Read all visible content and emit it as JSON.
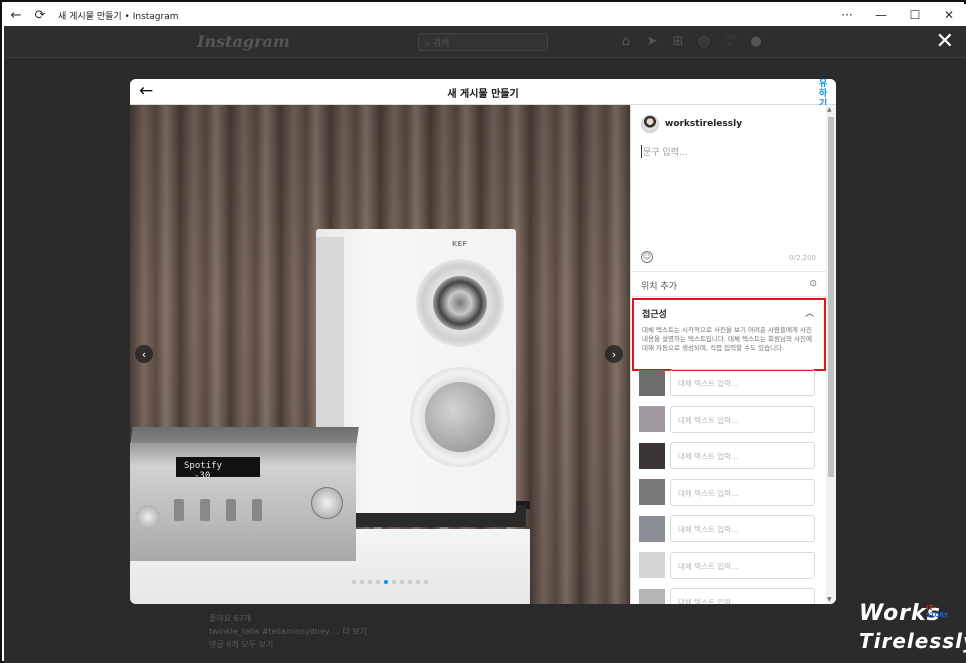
{
  "window": {
    "title": "새 게시물 만들기 • Instagram",
    "back_glyph": "←",
    "refresh_glyph": "⟳",
    "more_glyph": "···",
    "minimize_glyph": "—",
    "maximize_glyph": "☐",
    "close_glyph": "✕"
  },
  "instagram": {
    "logo": "Instagram",
    "search_placeholder": "검색",
    "nav_icons": [
      "home-icon",
      "direct-icon",
      "new-post-icon",
      "explore-icon",
      "activity-icon",
      "profile-icon"
    ],
    "overlay_close": "✕",
    "background_post": {
      "likes": "좋아요 67개",
      "caption_user": "twinkle_tella",
      "caption_text": "#tellaminsydney ... 더 보기",
      "comments": "댓글 6개 모두 보기"
    }
  },
  "modal": {
    "title": "새 게시물 만들기",
    "back_glyph": "←",
    "share_label": "공유하기",
    "share_visible": "유\n하\n기",
    "photo": {
      "display_text": "Spotify",
      "display_value": "-30",
      "brand": "KEF",
      "prev_glyph": "‹",
      "next_glyph": "›",
      "dots_count": 10,
      "active_dot": 4
    },
    "sidebar": {
      "username": "workstirelessly",
      "caption_placeholder": "문구 입력...",
      "char_counter": "0/2,200",
      "location_label": "위치 추가",
      "accessibility": {
        "heading": "접근성",
        "description": "대체 텍스트는 시각적으로 사진을 보기 어려운 사람들에게 사진 내용을 설명하는 텍스트입니다. 대체 텍스트는 회원님의 사진에 대해 자동으로 생성되며, 직접 입력할 수도 있습니다."
      },
      "alt_text_rows": [
        {
          "placeholder": "대체 텍스트 입력...",
          "thumb_color": "#6e6e6e"
        },
        {
          "placeholder": "대체 텍스트 입력...",
          "thumb_color": "#a09aa0"
        },
        {
          "placeholder": "대체 텍스트 입력...",
          "thumb_color": "#3a3438"
        },
        {
          "placeholder": "대체 텍스트 입력...",
          "thumb_color": "#7a7a78"
        },
        {
          "placeholder": "대체 텍스트 입력...",
          "thumb_color": "#8b8f95"
        },
        {
          "placeholder": "대체 텍스트 입력...",
          "thumb_color": "#d6d6d6"
        },
        {
          "placeholder": "대체 텍스트 입력...",
          "thumb_color": "#b5b5b5"
        }
      ]
    }
  },
  "watermark": {
    "line1": "Works",
    "line2": "Tirelessly",
    "it": "IT",
    "story": "STORY"
  },
  "colors": {
    "accent_blue": "#0095f6",
    "highlight_red": "#e0141b"
  }
}
